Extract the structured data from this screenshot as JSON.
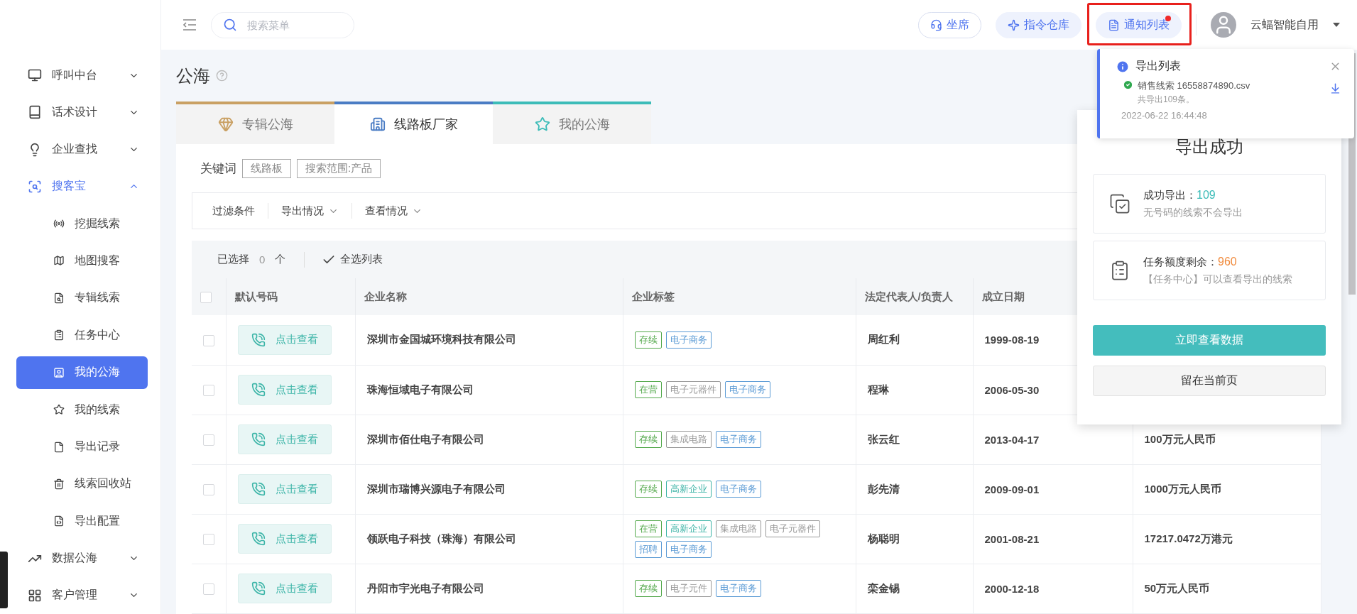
{
  "header": {
    "search": {
      "placeholder": "搜索菜单"
    },
    "buttons": [
      {
        "label": "坐席",
        "kind": "outline",
        "badge": false,
        "highlighted": false
      },
      {
        "label": "指令仓库",
        "kind": "filled",
        "badge": false,
        "highlighted": false
      },
      {
        "label": "通知列表",
        "kind": "filled",
        "badge": true,
        "highlighted": true
      }
    ],
    "user": {
      "name": "云蝠智能自用"
    }
  },
  "sidebar": {
    "items": [
      {
        "label": "呼叫中台",
        "expanded": false,
        "selected": false
      },
      {
        "label": "话术设计",
        "expanded": false,
        "selected": false
      },
      {
        "label": "企业查找",
        "expanded": false,
        "selected": false
      },
      {
        "label": "搜客宝",
        "expanded": true,
        "selected": true,
        "children": [
          {
            "label": "挖掘线索",
            "selected": false
          },
          {
            "label": "地图搜客",
            "selected": false
          },
          {
            "label": "专辑线索",
            "selected": false
          },
          {
            "label": "任务中心",
            "selected": false
          },
          {
            "label": "我的公海",
            "selected": true
          },
          {
            "label": "我的线索",
            "selected": false
          },
          {
            "label": "导出记录",
            "selected": false
          },
          {
            "label": "线索回收站",
            "selected": false
          },
          {
            "label": "导出配置",
            "selected": false
          }
        ]
      },
      {
        "label": "数据公海",
        "expanded": false,
        "selected": false
      },
      {
        "label": "客户管理",
        "expanded": false,
        "selected": false
      }
    ]
  },
  "page": {
    "title": "公海"
  },
  "tabs": [
    {
      "label": "专辑公海",
      "selected": false,
      "color": "#c9a063"
    },
    {
      "label": "线路板厂家",
      "selected": true,
      "color": "#4a7cc4"
    },
    {
      "label": "我的公海",
      "selected": false,
      "color": "#3cbcb8"
    }
  ],
  "keywords": {
    "label": "关键词",
    "tags": [
      "线路板",
      "搜索范围:产品"
    ]
  },
  "filters": [
    {
      "label": "过滤条件",
      "kind": "plain"
    },
    {
      "label": "导出情况",
      "kind": "dropdown"
    },
    {
      "label": "查看情况",
      "kind": "dropdown"
    }
  ],
  "selection": {
    "label": "已选择",
    "count": "0",
    "unit": "个",
    "select_all": "全选列表"
  },
  "table": {
    "all_checked": false,
    "columns": [
      "默认号码",
      "企业名称",
      "企业标签",
      "法定代表人/负责人",
      "成立日期"
    ],
    "rows": [
      {
        "checked": false,
        "phone": "点击查看",
        "company": "深圳市金国城环境科技有限公司",
        "tags": [
          {
            "label": "存续",
            "color": "#52a84a"
          },
          {
            "label": "电子商务",
            "color": "#5b9bd5"
          }
        ],
        "representative": "周红利",
        "founded": "1999-08-19"
      },
      {
        "checked": false,
        "phone": "点击查看",
        "company": "珠海恒域电子有限公司",
        "tags": [
          {
            "label": "在营",
            "color": "#52a84a"
          },
          {
            "label": "电子元器件",
            "color": "#999999"
          },
          {
            "label": "电子商务",
            "color": "#5b9bd5"
          }
        ],
        "representative": "程琳",
        "founded": "2006-05-30"
      },
      {
        "checked": false,
        "phone": "点击查看",
        "company": "深圳市佰仕电子有限公司",
        "tags": [
          {
            "label": "存续",
            "color": "#52a84a"
          },
          {
            "label": "集成电路",
            "color": "#999999"
          },
          {
            "label": "电子商务",
            "color": "#5b9bd5"
          }
        ],
        "representative": "张云红",
        "founded": "2013-04-17",
        "column_6": "100万元人民币"
      },
      {
        "checked": false,
        "phone": "点击查看",
        "company": "深圳市瑞博兴源电子有限公司",
        "tags": [
          {
            "label": "存续",
            "color": "#52a84a"
          },
          {
            "label": "高新企业",
            "color": "#3bb3a6"
          },
          {
            "label": "电子商务",
            "color": "#5b9bd5"
          }
        ],
        "representative": "彭先清",
        "founded": "2009-09-01",
        "column_6": "1000万元人民币"
      },
      {
        "checked": false,
        "phone": "点击查看",
        "company": "领跃电子科技（珠海）有限公司",
        "tags": [
          {
            "label": "在营",
            "color": "#52a84a"
          },
          {
            "label": "高新企业",
            "color": "#3bb3a6"
          },
          {
            "label": "集成电路",
            "color": "#999999"
          },
          {
            "label": "电子元器件",
            "color": "#999999"
          },
          {
            "label": "招聘",
            "color": "#5b9bd5"
          },
          {
            "label": "电子商务",
            "color": "#5b9bd5"
          }
        ],
        "representative": "杨聪明",
        "founded": "2001-08-21",
        "column_6": "17217.0472万港元"
      },
      {
        "checked": false,
        "phone": "点击查看",
        "company": "丹阳市宇光电子有限公司",
        "tags": [
          {
            "label": "存续",
            "color": "#52a84a"
          },
          {
            "label": "电子元件",
            "color": "#999999"
          },
          {
            "label": "电子商务",
            "color": "#5b9bd5"
          }
        ],
        "representative": "栾金锡",
        "founded": "2000-12-18",
        "column_6": "50万元人民币"
      }
    ]
  },
  "success_dialog": {
    "title": "导出成功",
    "stats": [
      {
        "kind": "success",
        "label": "成功导出：",
        "value": "109",
        "note": "无号码的线索不会导出"
      },
      {
        "kind": "quota",
        "label": "任务额度剩余：",
        "value": "960",
        "note": "【任务中心】可以查看导出的线索"
      }
    ],
    "primary_button": "立即查看数据",
    "secondary_button": "留在当前页"
  },
  "notification": {
    "title": "导出列表",
    "items": [
      {
        "file": "销售线索 16558874890.csv",
        "note": "共导出109条。"
      }
    ],
    "time": "2022-06-22 16:44:48"
  }
}
